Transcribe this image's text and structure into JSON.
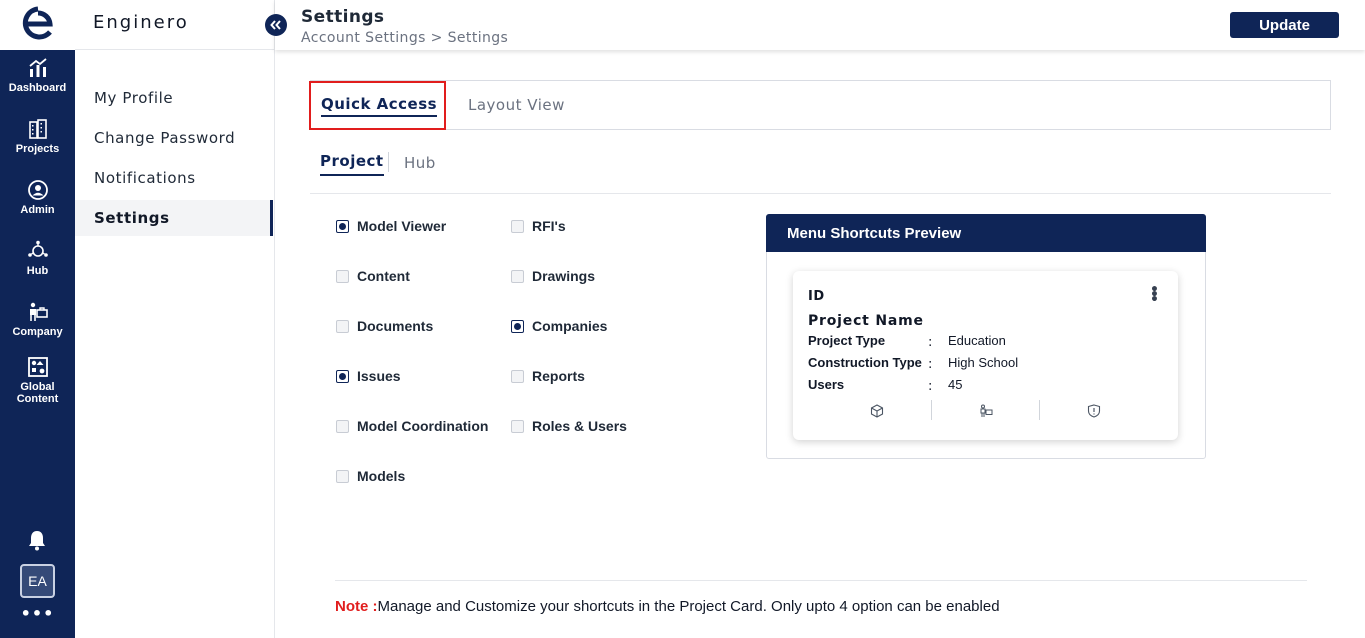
{
  "rail": {
    "items": [
      {
        "label": "Dashboard",
        "icon": "chart-icon"
      },
      {
        "label": "Projects",
        "icon": "building-icon"
      },
      {
        "label": "Admin",
        "icon": "user-gear-icon"
      },
      {
        "label": "Hub",
        "icon": "hub-icon"
      },
      {
        "label": "Company",
        "icon": "company-icon"
      },
      {
        "label": "Global",
        "label2": "Content",
        "icon": "grid-icon"
      }
    ],
    "avatar": "EA",
    "more": "•••"
  },
  "sidebar": {
    "brand": "Enginero",
    "items": [
      {
        "label": "My Profile"
      },
      {
        "label": "Change Password"
      },
      {
        "label": "Notifications"
      },
      {
        "label": "Settings"
      }
    ]
  },
  "header": {
    "title": "Settings",
    "breadcrumb": "Account Settings > Settings",
    "update_label": "Update"
  },
  "tabs": {
    "quick_access": "Quick Access",
    "layout_view": "Layout View"
  },
  "subtabs": {
    "project": "Project",
    "hub": "Hub"
  },
  "options": {
    "left": [
      {
        "label": "Model Viewer",
        "checked": true
      },
      {
        "label": "Content",
        "checked": false
      },
      {
        "label": "Documents",
        "checked": false
      },
      {
        "label": "Issues",
        "checked": true
      },
      {
        "label": "Model Coordination",
        "checked": false
      },
      {
        "label": "Models",
        "checked": false
      }
    ],
    "right": [
      {
        "label": "RFI's",
        "checked": false
      },
      {
        "label": "Drawings",
        "checked": false
      },
      {
        "label": "Companies",
        "checked": true
      },
      {
        "label": "Reports",
        "checked": false
      },
      {
        "label": "Roles & Users",
        "checked": false
      }
    ]
  },
  "preview": {
    "title": "Menu Shortcuts Preview",
    "card": {
      "id": "ID",
      "name": "Project Name",
      "fields": [
        {
          "key": "Project Type",
          "colon": ":",
          "value": "Education"
        },
        {
          "key": "Construction Type",
          "colon": ":",
          "value": "High School"
        },
        {
          "key": "Users",
          "colon": ":",
          "value": "45"
        }
      ],
      "shortcut_icons": [
        "cube-icon",
        "company-icon",
        "shield-icon"
      ]
    }
  },
  "note": {
    "key": "Note :",
    "text": "Manage and Customize your shortcuts in the Project Card. Only upto 4 option can be enabled"
  },
  "colors": {
    "navy": "#0f2557",
    "highlight": "#e11d1d"
  }
}
